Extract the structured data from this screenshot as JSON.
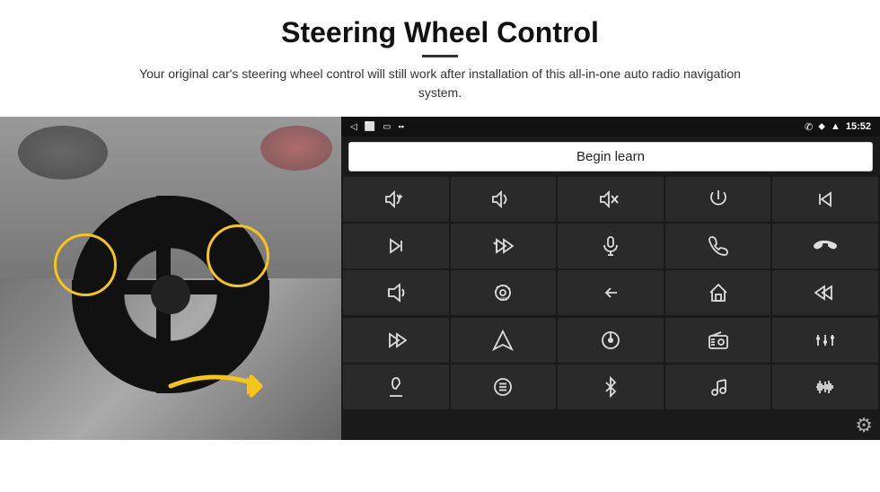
{
  "header": {
    "title": "Steering Wheel Control",
    "divider": true,
    "description": "Your original car's steering wheel control will still work after installation of this all-in-one auto radio navigation system."
  },
  "android": {
    "status_bar": {
      "back_icon": "◁",
      "home_icon": "⬜",
      "recents_icon": "▭",
      "battery_icon": "▪▪",
      "phone_icon": "✆",
      "location_icon": "⬥",
      "wifi_icon": "▲",
      "time": "15:52"
    },
    "begin_learn_label": "Begin learn",
    "icon_rows": [
      [
        "vol+",
        "vol-",
        "mute",
        "power",
        "prev-track"
      ],
      [
        "next",
        "skip-fwd",
        "mic",
        "phone",
        "hang-up"
      ],
      [
        "horn",
        "360-cam",
        "back",
        "home",
        "prev"
      ],
      [
        "fast-fwd",
        "navigate",
        "source",
        "radio",
        "eq"
      ],
      [
        "voice",
        "menu",
        "bluetooth",
        "music",
        "waveform"
      ]
    ]
  }
}
